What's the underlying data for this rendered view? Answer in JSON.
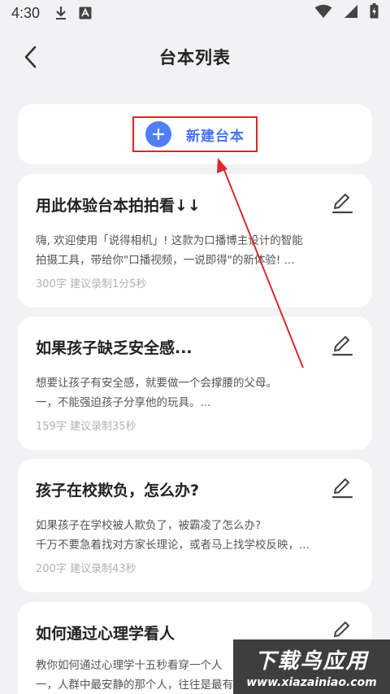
{
  "status_bar": {
    "time": "4:30",
    "left_icons": [
      "download-icon",
      "app-notification-icon"
    ],
    "right_icons": [
      "wifi-icon",
      "signal-icon",
      "battery-icon"
    ]
  },
  "header": {
    "title": "台本列表",
    "back_icon": "chevron-left-icon"
  },
  "new_script": {
    "label": "新建台本",
    "icon": "plus-circle-icon",
    "highlight_color": "#e02424",
    "accent_color": "#4a73e8"
  },
  "scripts": [
    {
      "title": "用此体验台本拍拍看↓↓",
      "lines": [
        "嗨, 欢迎使用「说得相机」! 这款为口播博主设计的智能",
        "拍摄工具，带给你\"口播视频，一说即得\"的新体验! ..."
      ],
      "meta": "300字 建议录制1分5秒"
    },
    {
      "title": "如果孩子缺乏安全感...",
      "lines": [
        "想要让孩子有安全感，就要做一个会撑腰的父母。",
        "一，不能强迫孩子分享他的玩具。..."
      ],
      "meta": "159字 建议录制35秒"
    },
    {
      "title": "孩子在校欺负，怎么办?",
      "lines": [
        "如果孩子在学校被人欺负了，被霸凌了怎么办?",
        "千万不要急着找对方家长理论，或者马上找学校反映，..."
      ],
      "meta": "200字 建议录制43秒"
    },
    {
      "title": "如何通过心理学看人",
      "lines": [
        "教你如何通过心理学十五秒看穿一个人",
        "一，人群中最安静的那个人，往往是最有实力的"
      ],
      "meta": ""
    }
  ],
  "watermark": {
    "name": "下载鸟应用",
    "url": "www.xiazainiao.com"
  },
  "annotation": {
    "arrow_color": "#d92b2b"
  }
}
